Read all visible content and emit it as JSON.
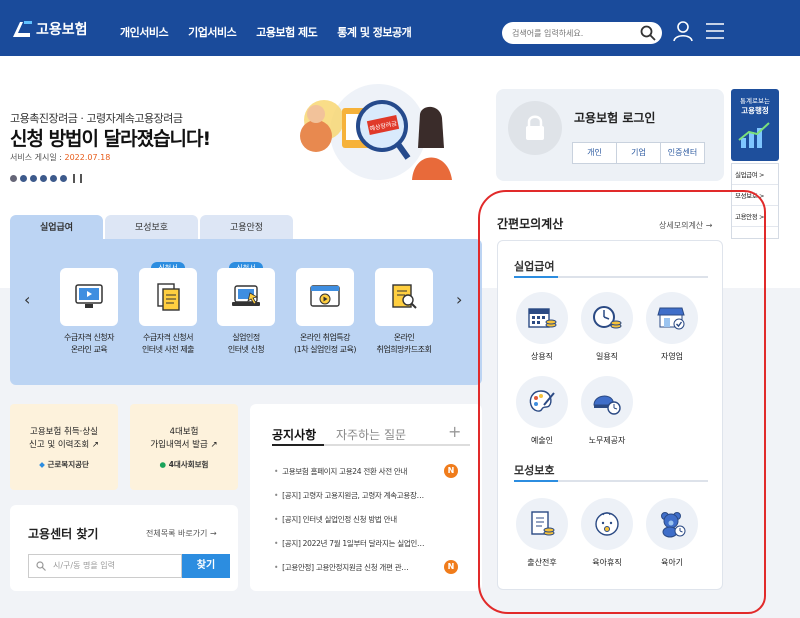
{
  "header": {
    "brand": "고용보험",
    "nav": [
      "개인서비스",
      "기업서비스",
      "고용보험 제도",
      "통계 및 정보공개"
    ],
    "search_placeholder": "검색어를 입력하세요."
  },
  "banner": {
    "subtitle": "고용촉진장려금 · 고령자계속고용장려금",
    "title": "신청 방법이 달라졌습니다!",
    "date_label": "서비스 게시일 :",
    "date": "2022.07.18",
    "sign_text": "예상장려금"
  },
  "tabs": [
    "실업급여",
    "모성보호",
    "고용안정"
  ],
  "services": [
    {
      "label1": "수급자격 신청자",
      "label2": "온라인 교육",
      "badge": ""
    },
    {
      "label1": "수급자격 신청서",
      "label2": "인터넷 사전 제출",
      "badge": "신청서"
    },
    {
      "label1": "실업인정",
      "label2": "인터넷 신청",
      "badge": "신청서"
    },
    {
      "label1": "온라인 취업특강",
      "label2": "(1차 실업인정 교육)",
      "badge": ""
    },
    {
      "label1": "온라인",
      "label2": "취업희망카드조회",
      "badge": ""
    }
  ],
  "quick_cards": [
    {
      "line1": "고용보험 취득·상실",
      "line2": "신고 및 이력조회",
      "org": "근로복지공단"
    },
    {
      "line1": "4대보험",
      "line2": "가입내역서 발급",
      "org": "4대사회보험"
    }
  ],
  "center_finder": {
    "title": "고용센터 찾기",
    "link": "전체목록 바로가기",
    "placeholder": "시/구/동 명을 입력",
    "button": "찾기"
  },
  "notice": {
    "tab_active": "공지사항",
    "tab_other": "자주하는 질문",
    "plus": "+",
    "new_label": "N",
    "items": [
      {
        "text": "고용보험 홈페이지 고용24 전환 사전 안내",
        "new": true
      },
      {
        "text": "[공지] 고령자 고용지원금, 고령자 계속고용장…",
        "new": false
      },
      {
        "text": "[공지] 인터넷 실업인정 신청 방법 안내",
        "new": false
      },
      {
        "text": "[공지] 2022년 7월 1일부터 달라지는 실업인…",
        "new": false
      },
      {
        "text": "[고용안정] 고용안정지원금 신청 개편 관…",
        "new": true
      }
    ]
  },
  "login": {
    "title": "고용보험 로그인",
    "buttons": [
      "개인",
      "기업",
      "인증센터"
    ]
  },
  "stats": {
    "line1": "통계로보는",
    "line2": "고용행정"
  },
  "quick_links": [
    "실업급여 >",
    "모성보호 >",
    "고용안정 >"
  ],
  "calculator": {
    "title": "간편모의계산",
    "link": "상세모의계산",
    "sections": [
      {
        "name": "실업급여",
        "items": [
          "상용직",
          "일용직",
          "자영업",
          "예술인",
          "노무제공자"
        ]
      },
      {
        "name": "모성보호",
        "items": [
          "출산전후",
          "육아휴직",
          "육아기"
        ]
      }
    ]
  },
  "colors": {
    "header": "#1a4b9b",
    "accent": "#2c8de0",
    "tab_panel": "#bcd4f3",
    "annotation": "#e12a2a"
  }
}
